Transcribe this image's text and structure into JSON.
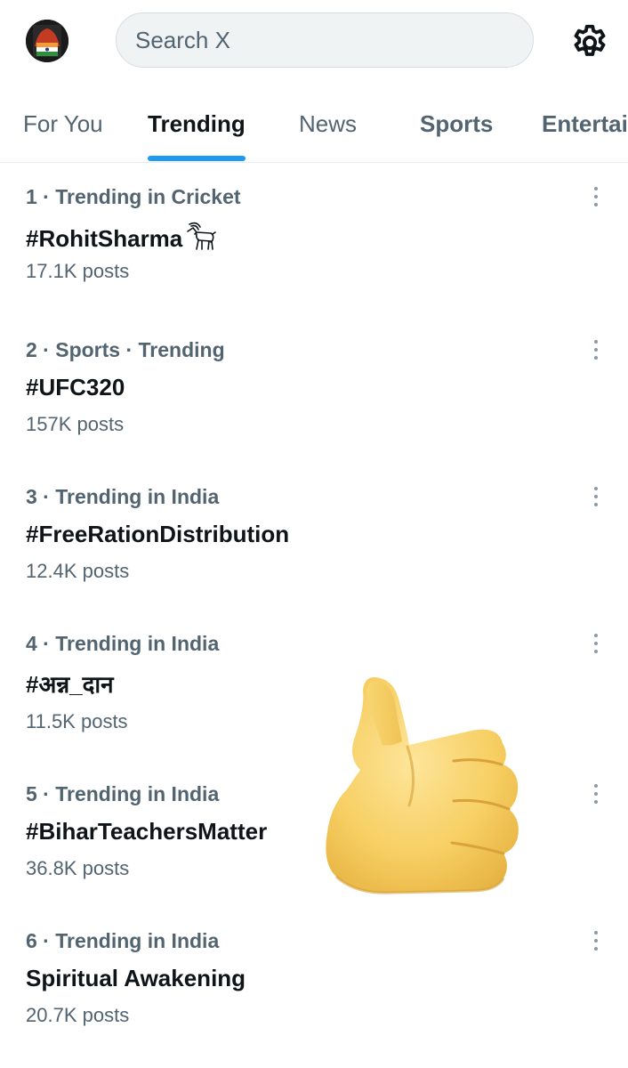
{
  "header": {
    "search_placeholder": "Search X"
  },
  "tabs": [
    {
      "label": "For You"
    },
    {
      "label": "Trending"
    },
    {
      "label": "News"
    },
    {
      "label": "Sports"
    },
    {
      "label": "Entertai"
    }
  ],
  "active_tab": "Trending",
  "trends": [
    {
      "meta": "1 · Trending in Cricket",
      "title": "#RohitSharma",
      "count": "17.1K posts"
    },
    {
      "meta": "2 · Sports · Trending",
      "title": "#UFC320",
      "count": "157K posts"
    },
    {
      "meta": "3 · Trending in India",
      "title": "#FreeRationDistribution",
      "count": "12.4K posts"
    },
    {
      "meta": "4 · Trending in India",
      "title": "#अन्न_दान",
      "count": "11.5K posts"
    },
    {
      "meta": "5 · Trending in India",
      "title": "#BiharTeachersMatter",
      "count": "36.8K posts"
    },
    {
      "meta": "6 · Trending in India",
      "title": "Spiritual Awakening",
      "count": "20.7K posts"
    }
  ],
  "icons": {
    "settings": "gear-icon",
    "more": "more-vertical-icon",
    "goat": "goat-emoji-icon",
    "thumbs_up": "thumbs-up-sticker"
  },
  "colors": {
    "accent": "#1d9bf0",
    "text_primary": "#0f1419",
    "text_secondary": "#536471",
    "search_bg": "#eff3f4"
  }
}
